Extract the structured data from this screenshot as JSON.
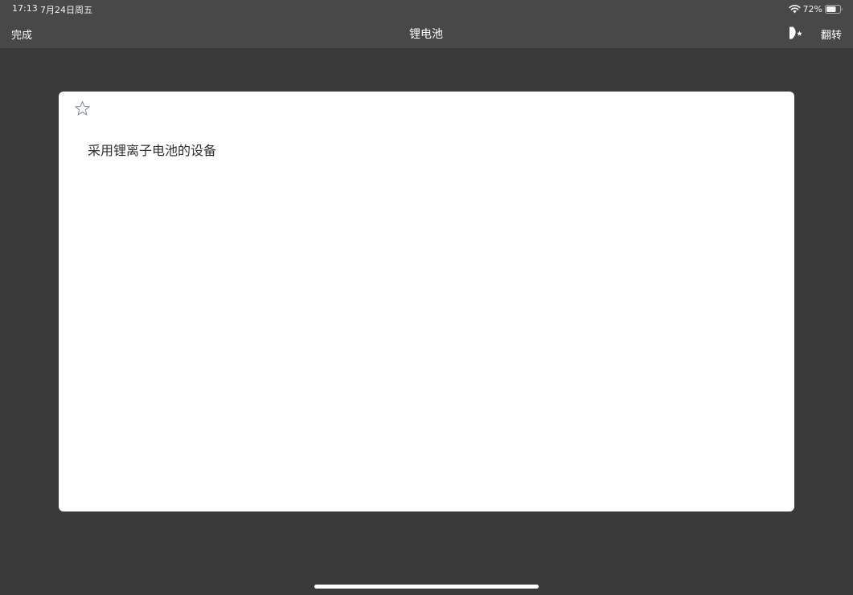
{
  "status_bar": {
    "time": "17:13",
    "date": "7月24日周五",
    "battery_percent": "72%",
    "battery_level": 0.72,
    "wifi_icon": "wifi-icon",
    "battery_icon": "battery-icon"
  },
  "nav": {
    "done_label": "完成",
    "title": "锂电池",
    "speak_icon": "speaker-icon",
    "flip_label": "翻转"
  },
  "card": {
    "star_icon": "star-outline-icon",
    "text": "采用锂离子电池的设备"
  },
  "colors": {
    "background": "#3a3a3a",
    "top_bar": "#484848",
    "card": "#ffffff",
    "star": "#8a8f9c",
    "card_text": "#2e2e2e"
  }
}
